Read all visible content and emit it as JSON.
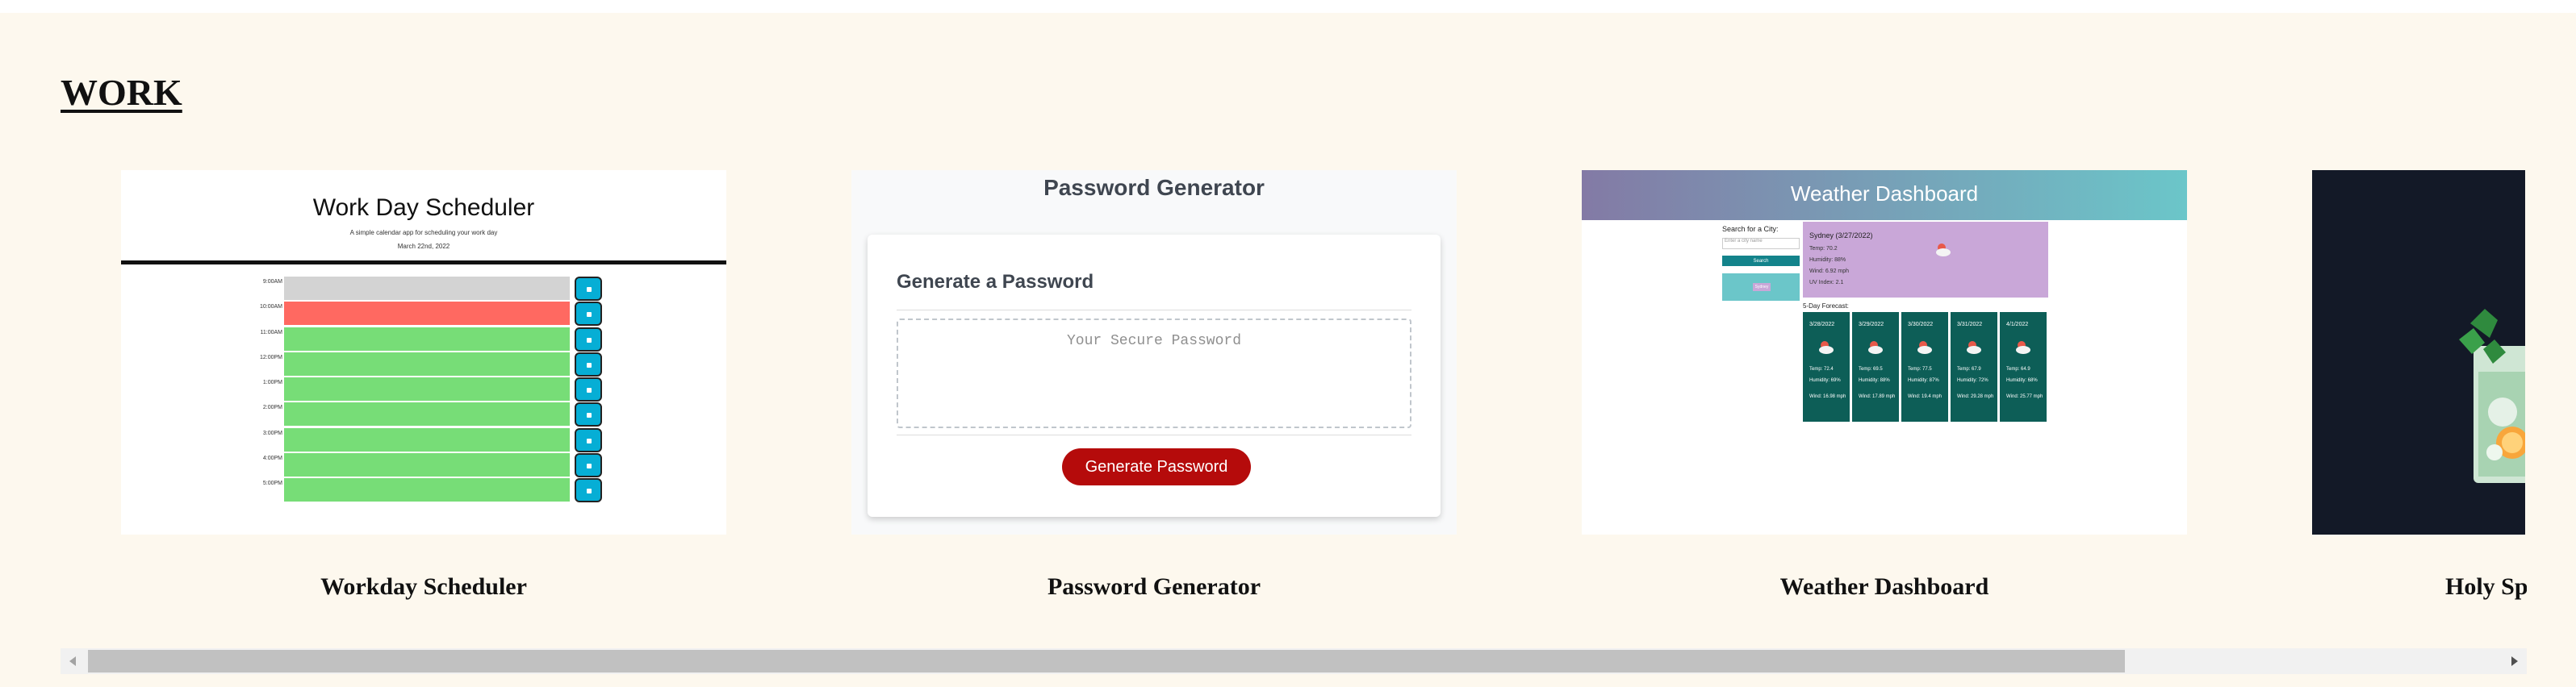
{
  "section": {
    "title": "WORK"
  },
  "projects": [
    {
      "caption": "Workday Scheduler",
      "preview": {
        "title": "Work Day Scheduler",
        "subtitle": "A simple calendar app for scheduling your work day",
        "date": "March 22nd, 2022",
        "hours": [
          "9:00AM",
          "10:00AM",
          "11:00AM",
          "12:00PM",
          "1:00PM",
          "2:00PM",
          "3:00PM",
          "4:00PM",
          "5:00PM"
        ],
        "row_colors": [
          "#d3d3d3",
          "#ff6961",
          "#77dd77",
          "#77dd77",
          "#77dd77",
          "#77dd77",
          "#77dd77",
          "#77dd77",
          "#77dd77"
        ],
        "save_color": "#06aed5"
      }
    },
    {
      "caption": "Password Generator",
      "preview": {
        "heading": "Password Generator",
        "panel_title": "Generate a Password",
        "textarea_placeholder": "Your Secure Password",
        "button_label": "Generate Password",
        "button_color": "#b50b0b"
      }
    },
    {
      "caption": "Weather Dashboard",
      "preview": {
        "title": "Weather Dashboard",
        "search_label": "Search for a City:",
        "search_placeholder": "Enter a city name",
        "search_button": "Search",
        "history_button": "Sydney",
        "current": {
          "city": "Sydney (3/27/2022)",
          "temp": "Temp: 70.2",
          "humidity": "Humidity: 88%",
          "wind": "Wind: 6.92 mph",
          "uv": "UV Index: 2.1"
        },
        "forecast_label": "5-Day Forecast:",
        "forecast": [
          {
            "date": "3/28/2022",
            "temp": "Temp: 72.4",
            "humidity": "Humidity: 69%",
            "wind": "Wind: 16.98 mph"
          },
          {
            "date": "3/29/2022",
            "temp": "Temp: 69.5",
            "humidity": "Humidity: 88%",
            "wind": "Wind: 17.89 mph"
          },
          {
            "date": "3/30/2022",
            "temp": "Temp: 77.5",
            "humidity": "Humidity: 87%",
            "wind": "Wind: 19.4 mph"
          },
          {
            "date": "3/31/2022",
            "temp": "Temp: 67.9",
            "humidity": "Humidity: 72%",
            "wind": "Wind: 29.28 mph"
          },
          {
            "date": "4/1/2022",
            "temp": "Temp: 64.9",
            "humidity": "Humidity: 68%",
            "wind": "Wind: 25.77 mph"
          }
        ]
      }
    },
    {
      "caption": "Holy Sp"
    }
  ],
  "colors": {
    "page_background": "#fdf8ee",
    "scrollbar_thumb": "#c1c1c1"
  }
}
